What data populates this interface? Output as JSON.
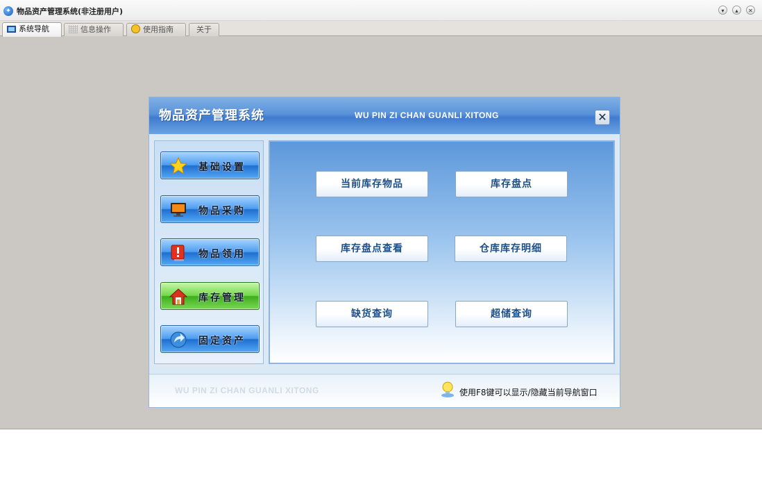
{
  "window": {
    "title": "物品资产管理系统(非注册用户)",
    "controls": [
      "minimize",
      "maximize",
      "close"
    ]
  },
  "tabs": [
    {
      "label": "系统导航",
      "icon": "monitor-icon",
      "active": true
    },
    {
      "label": "信息操作",
      "icon": "grid-icon",
      "active": false
    },
    {
      "label": "使用指南",
      "icon": "smiley-icon",
      "active": false
    },
    {
      "label": "关于",
      "icon": "",
      "active": false
    }
  ],
  "panel": {
    "title": "物品资产管理系统",
    "subtitle": "WU PIN ZI CHAN GUANLI XITONG",
    "close_label": "✕"
  },
  "nav": [
    {
      "label": "基础设置",
      "icon": "star-icon",
      "active": false
    },
    {
      "label": "物品采购",
      "icon": "monitor-icon",
      "active": false
    },
    {
      "label": "物品领用",
      "icon": "alert-icon",
      "active": false
    },
    {
      "label": "库存管理",
      "icon": "house-icon",
      "active": true
    },
    {
      "label": "固定资产",
      "icon": "arrow-icon",
      "active": false
    }
  ],
  "functions": [
    {
      "label": "当前库存物品"
    },
    {
      "label": "库存盘点"
    },
    {
      "label": "库存盘点查看"
    },
    {
      "label": "仓库库存明细"
    },
    {
      "label": "缺货查询"
    },
    {
      "label": "超储查询"
    }
  ],
  "footer": {
    "watermark": "WU PIN ZI CHAN GUANLI XITONG",
    "hint": "使用F8键可以显示/隐藏当前导航窗口"
  },
  "colors": {
    "header_blue": "#3f7bd0",
    "button_blue": "#1f6fd1",
    "button_green": "#3eae1b",
    "function_text": "#1d4f86",
    "desktop_gray": "#cbc7c3"
  }
}
